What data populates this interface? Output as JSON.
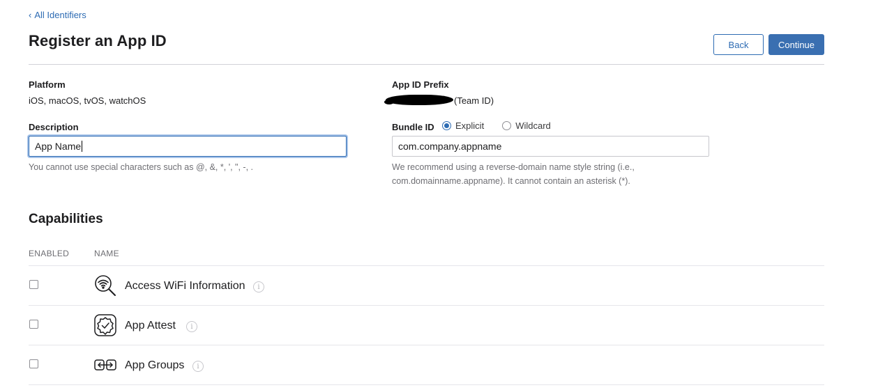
{
  "nav": {
    "back_link": "All Identifiers",
    "back_chevron": "‹"
  },
  "header": {
    "title": "Register an App ID",
    "back_button": "Back",
    "continue_button": "Continue"
  },
  "form": {
    "platform_label": "Platform",
    "platform_value": "iOS, macOS, tvOS, watchOS",
    "prefix_label": "App ID Prefix",
    "prefix_suffix": "(Team ID)",
    "description_label": "Description",
    "description_value": "App Name",
    "description_hint": "You cannot use special characters such as @, &, *, ', \", -, .",
    "bundle_label": "Bundle ID",
    "bundle_options": [
      "Explicit",
      "Wildcard"
    ],
    "bundle_selected": "Explicit",
    "bundle_value": "com.company.appname",
    "bundle_hint_line1": "We recommend using a reverse-domain name style string (i.e.,",
    "bundle_hint_line2": "com.domainname.appname). It cannot contain an asterisk (*)."
  },
  "capabilities": {
    "title": "Capabilities",
    "col_enabled": "ENABLED",
    "col_name": "NAME",
    "items": [
      {
        "name": "Access WiFi Information",
        "icon": "wifi-search-icon",
        "enabled": false
      },
      {
        "name": "App Attest",
        "icon": "badge-check-icon",
        "enabled": false
      },
      {
        "name": "App Groups",
        "icon": "app-groups-icon",
        "enabled": false
      }
    ]
  },
  "colors": {
    "accent": "#2d6bb3",
    "primary_button": "#3a6fb1",
    "hint_text": "#6e6e73"
  }
}
